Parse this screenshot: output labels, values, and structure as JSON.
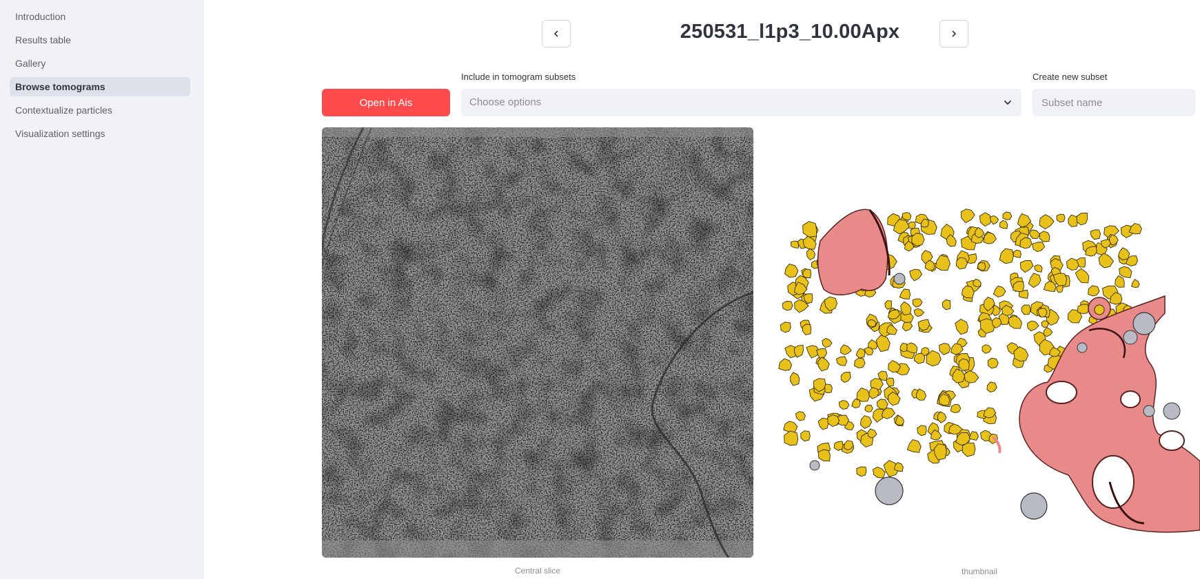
{
  "sidebar": {
    "items": [
      {
        "label": "Introduction",
        "active": false
      },
      {
        "label": "Results table",
        "active": false
      },
      {
        "label": "Gallery",
        "active": false
      },
      {
        "label": "Browse tomograms",
        "active": true
      },
      {
        "label": "Contextualize particles",
        "active": false
      },
      {
        "label": "Visualization settings",
        "active": false
      }
    ]
  },
  "header": {
    "title": "250531_l1p3_10.00Apx",
    "prev_icon": "chevron-left-icon",
    "next_icon": "chevron-right-icon"
  },
  "controls": {
    "open_button": "Open in Ais",
    "subsets_label": "Include in tomogram subsets",
    "subsets_placeholder": "Choose options",
    "new_subset_label": "Create new subset",
    "new_subset_placeholder": "Subset name"
  },
  "images": {
    "slice_caption": "Central slice",
    "thumb_caption": "thumbnail"
  },
  "colors": {
    "accent": "#ff4b4b",
    "sidebar_bg": "#f0f2f6",
    "membrane": "#e88a8a",
    "particles": "#e8c21a",
    "vesicles": "#b8bac4"
  }
}
